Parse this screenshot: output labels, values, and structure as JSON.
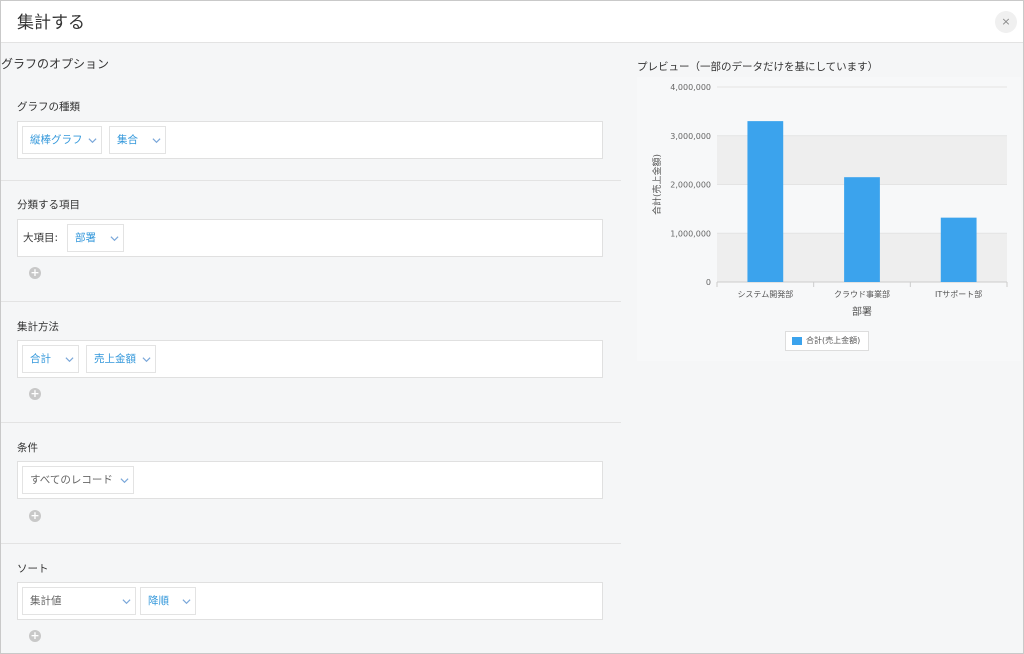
{
  "dialog": {
    "title": "集計する",
    "close_label": "×"
  },
  "options": {
    "title": "グラフのオプション",
    "graph_type": {
      "label": "グラフの種類",
      "chart_type": "縦棒グラフ",
      "mode": "集合"
    },
    "category": {
      "label": "分類する項目",
      "item_label": "大項目:",
      "item_value": "部署"
    },
    "aggregation": {
      "label": "集計方法",
      "method": "合計",
      "field": "売上金額"
    },
    "condition": {
      "label": "条件",
      "value": "すべてのレコード"
    },
    "sort": {
      "label": "ソート",
      "key": "集計値",
      "order": "降順"
    },
    "add_label": "+"
  },
  "preview": {
    "title": "プレビュー（一部のデータだけを基にしています）"
  },
  "chart_data": {
    "type": "bar",
    "categories": [
      "システム開発部",
      "クラウド事業部",
      "ITサポート部"
    ],
    "series": [
      {
        "name": "合計(売上金額)",
        "values": [
          3300000,
          2150000,
          1320000
        ],
        "color": "#3ba3ed"
      }
    ],
    "xlabel": "部署",
    "ylabel": "合計(売上金額)",
    "ylim": [
      0,
      4000000
    ],
    "yticks": [
      0,
      1000000,
      2000000,
      3000000,
      4000000
    ],
    "ytick_labels": [
      "0",
      "1,000,000",
      "2,000,000",
      "3,000,000",
      "4,000,000"
    ],
    "legend_position": "bottom",
    "grid": true
  }
}
